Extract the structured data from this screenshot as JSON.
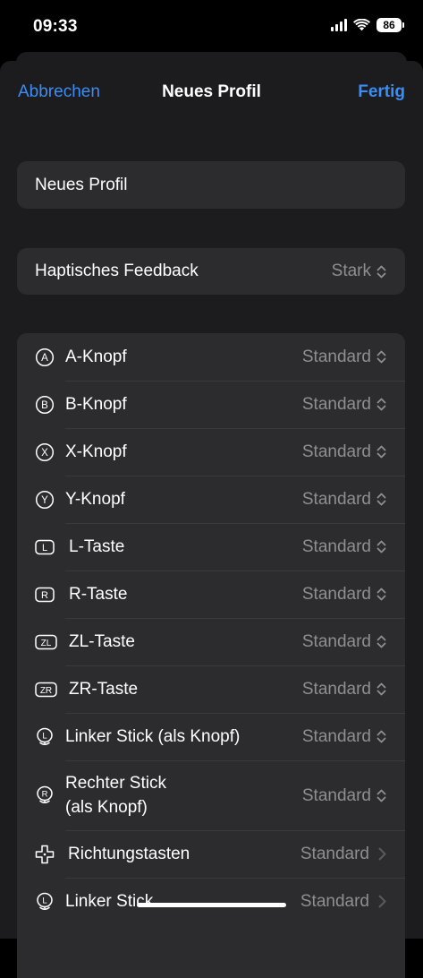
{
  "status_bar": {
    "time": "09:33",
    "battery": "86"
  },
  "nav": {
    "cancel": "Abbrechen",
    "title": "Neues Profil",
    "done": "Fertig"
  },
  "profile_name": {
    "value": "Neues Profil"
  },
  "haptic": {
    "label": "Haptisches Feedback",
    "value": "Stark"
  },
  "mappings": [
    {
      "label": "A-Knopf",
      "value": "Standard",
      "icon": "a-button-icon",
      "glyph": "A",
      "shape": "circle",
      "control": "updown"
    },
    {
      "label": "B-Knopf",
      "value": "Standard",
      "icon": "b-button-icon",
      "glyph": "B",
      "shape": "circle",
      "control": "updown"
    },
    {
      "label": "X-Knopf",
      "value": "Standard",
      "icon": "x-button-icon",
      "glyph": "X",
      "shape": "circle",
      "control": "updown"
    },
    {
      "label": "Y-Knopf",
      "value": "Standard",
      "icon": "y-button-icon",
      "glyph": "Y",
      "shape": "circle",
      "control": "updown"
    },
    {
      "label": "L-Taste",
      "value": "Standard",
      "icon": "l-shoulder-icon",
      "glyph": "L",
      "shape": "rect",
      "control": "updown"
    },
    {
      "label": "R-Taste",
      "value": "Standard",
      "icon": "r-shoulder-icon",
      "glyph": "R",
      "shape": "rect",
      "control": "updown"
    },
    {
      "label": "ZL-Taste",
      "value": "Standard",
      "icon": "zl-trigger-icon",
      "glyph": "ZL",
      "shape": "rect",
      "control": "updown"
    },
    {
      "label": "ZR-Taste",
      "value": "Standard",
      "icon": "zr-trigger-icon",
      "glyph": "ZR",
      "shape": "rect",
      "control": "updown"
    },
    {
      "label": "Linker Stick (als Knopf)",
      "value": "Standard",
      "icon": "left-stick-icon",
      "glyph": "L",
      "shape": "stick",
      "control": "updown"
    },
    {
      "label": "Rechter Stick\n(als Knopf)",
      "value": "Standard",
      "icon": "right-stick-icon",
      "glyph": "R",
      "shape": "stick",
      "control": "updown"
    },
    {
      "label": "Richtungstasten",
      "value": "Standard",
      "icon": "dpad-icon",
      "glyph": "",
      "shape": "dpad",
      "control": "disclosure"
    },
    {
      "label": "Linker Stick",
      "value": "Standard",
      "icon": "left-stick-icon",
      "glyph": "L",
      "shape": "stick",
      "control": "disclosure"
    }
  ],
  "colors": {
    "accent": "#3a8df5",
    "background": "#000000",
    "sheet": "#1c1c1e",
    "card": "#2c2c2e",
    "secondary_text": "#8e8e93"
  }
}
